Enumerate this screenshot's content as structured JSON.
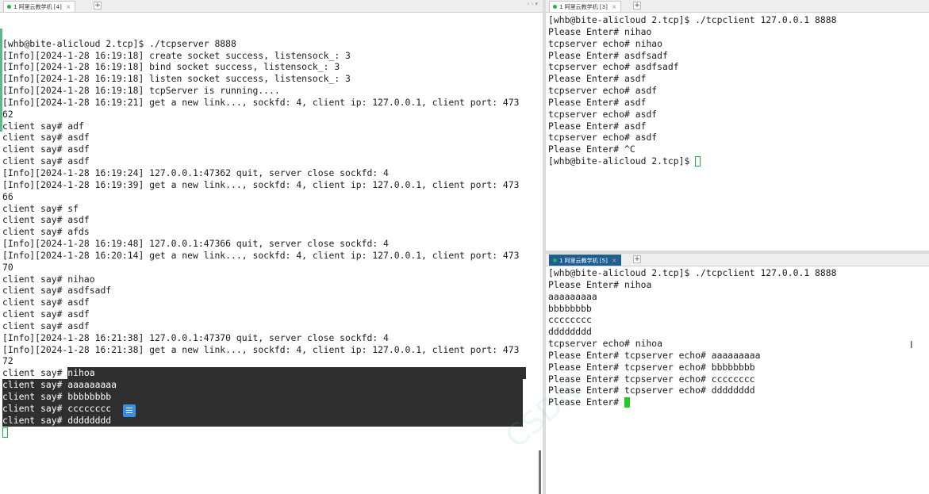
{
  "left_pane": {
    "tab_label": "1 阿里云教学机 [4]",
    "lines": [
      "[whb@bite-alicloud 2.tcp]$ ./tcpserver 8888",
      "[Info][2024-1-28 16:19:18] create socket success, listensock_: 3",
      "[Info][2024-1-28 16:19:18] bind socket success, listensock_: 3",
      "[Info][2024-1-28 16:19:18] listen socket success, listensock_: 3",
      "[Info][2024-1-28 16:19:18] tcpServer is running....",
      "[Info][2024-1-28 16:19:21] get a new link..., sockfd: 4, client ip: 127.0.0.1, client port: 473",
      "62",
      "client say# adf",
      "client say# asdf",
      "client say# asdf",
      "client say# asdf",
      "[Info][2024-1-28 16:19:24] 127.0.0.1:47362 quit, server close sockfd: 4",
      "[Info][2024-1-28 16:19:39] get a new link..., sockfd: 4, client ip: 127.0.0.1, client port: 473",
      "66",
      "client say# sf",
      "client say# asdf",
      "client say# afds",
      "[Info][2024-1-28 16:19:48] 127.0.0.1:47366 quit, server close sockfd: 4",
      "[Info][2024-1-28 16:20:14] get a new link..., sockfd: 4, client ip: 127.0.0.1, client port: 473",
      "70",
      "client say# nihao",
      "client say# asdfsadf",
      "client say# asdf",
      "client say# asdf",
      "client say# asdf",
      "[Info][2024-1-28 16:21:38] 127.0.0.1:47370 quit, server close sockfd: 4",
      "[Info][2024-1-28 16:21:38] get a new link..., sockfd: 4, client ip: 127.0.0.1, client port: 473",
      "72"
    ],
    "selected_first_prefix": "client say# ",
    "selected_first_text": "nihoa",
    "selected_lines": [
      "client say# aaaaaaaaa",
      "client say# bbbbbbbb",
      "client say# cccccccc",
      "client say# dddddddd"
    ]
  },
  "right_top_pane": {
    "tab_label": "1 阿里云教学机 [3]",
    "lines": [
      "[whb@bite-alicloud 2.tcp]$ ./tcpclient 127.0.0.1 8888",
      "Please Enter# nihao",
      "tcpserver echo# nihao",
      "Please Enter# asdfsadf",
      "tcpserver echo# asdfsadf",
      "Please Enter# asdf",
      "tcpserver echo# asdf",
      "Please Enter# asdf",
      "tcpserver echo# asdf",
      "Please Enter# asdf",
      "tcpserver echo# asdf",
      "Please Enter# ^C"
    ],
    "prompt": "[whb@bite-alicloud 2.tcp]$ "
  },
  "right_bottom_pane": {
    "tab_label": "1 阿里云教学机 [5]",
    "lines": [
      "[whb@bite-alicloud 2.tcp]$ ./tcpclient 127.0.0.1 8888",
      "Please Enter# nihoa",
      "aaaaaaaaa",
      "bbbbbbbb",
      "cccccccc",
      "dddddddd",
      "tcpserver echo# nihoa",
      "Please Enter# tcpserver echo# aaaaaaaaa",
      "Please Enter# tcpserver echo# bbbbbbbb",
      "Please Enter# tcpserver echo# cccccccc",
      "Please Enter# tcpserver echo# dddddddd"
    ],
    "prompt": "Please Enter# "
  },
  "tab_bar": {
    "plus": "+",
    "nav_arrows": "‹ ›  ▾"
  },
  "colors": {
    "active_tab": "#1e5f93",
    "selection": "#2f2f2f",
    "cursor": "#22cc22",
    "status_dot": "#22b04b"
  },
  "icons": {
    "left_note": "note-icon",
    "mouse": "text-cursor-icon"
  }
}
